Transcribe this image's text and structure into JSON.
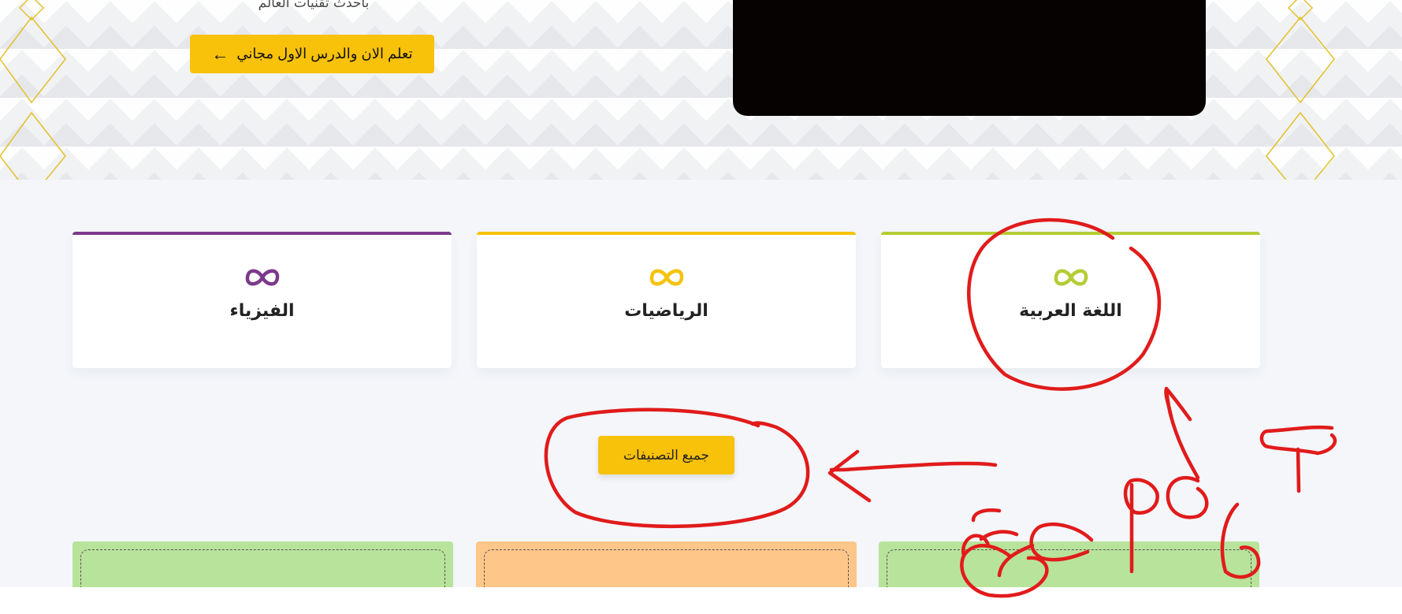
{
  "hero": {
    "subtitle": "باحدث تقنيات العالم",
    "cta_label": "تعلم الان والدرس الاول مجاني",
    "cta_arrow": "←"
  },
  "categories": [
    {
      "label": "الفيزياء",
      "color": "#7b3a8c",
      "icon": "infinity-icon"
    },
    {
      "label": "الرياضيات",
      "color": "#f5c20d",
      "icon": "infinity-icon"
    },
    {
      "label": "اللغة العربية",
      "color": "#b5cc35",
      "icon": "infinity-icon"
    }
  ],
  "all_categories_label": "جميع التصنيفات",
  "tiles": [
    {
      "color": "#b8e39a"
    },
    {
      "color": "#ffc68a"
    },
    {
      "color": "#b8e39a"
    }
  ],
  "colors": {
    "accent": "#f8c10a",
    "annotation": "#e11b1b"
  }
}
